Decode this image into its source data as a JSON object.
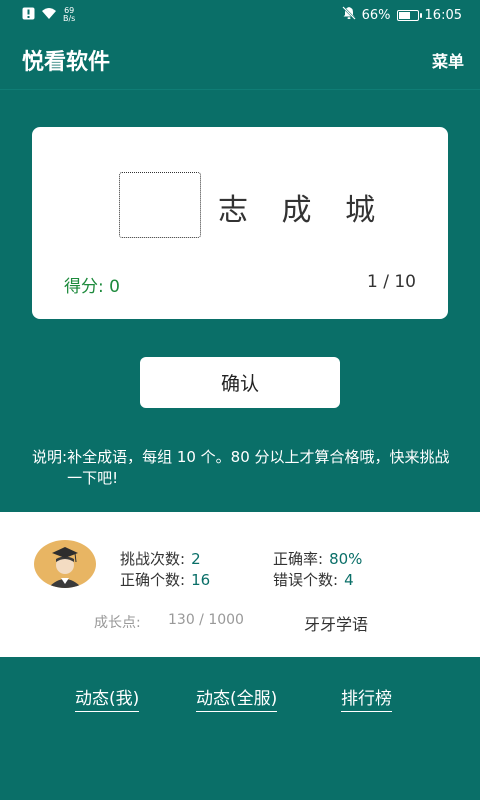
{
  "status_bar": {
    "net_speed_value": "69",
    "net_speed_unit": "B/s",
    "battery": "66%",
    "battery_level": 0.66,
    "time": "16:05"
  },
  "app_bar": {
    "title": "悦看软件",
    "menu_label": "菜单"
  },
  "quiz": {
    "idiom_chars": "志 成 城",
    "score_label": "得分:",
    "score_value": "0",
    "progress": "1 / 10"
  },
  "confirm_label": "确认",
  "note": {
    "label": "说明:",
    "text": "补全成语，每组 10 个。80 分以上才算合格哦，快来挑战一下吧!"
  },
  "stats": {
    "attempts_label": "挑战次数:",
    "attempts_value": "2",
    "accuracy_label": "正确率:",
    "accuracy_value": "80%",
    "correct_label": "正确个数:",
    "correct_value": "16",
    "wrong_label": "错误个数:",
    "wrong_value": "4",
    "growth_label": "成长点:",
    "growth_value": "130 / 1000",
    "level": "牙牙学语"
  },
  "bottom_nav": {
    "my_feed": "动态(我)",
    "all_feed": "动态(全服)",
    "ranking": "排行榜"
  },
  "colors": {
    "primary": "#0a6f68",
    "score_green": "#1d8a3c",
    "avatar_bg": "#e8b563"
  }
}
